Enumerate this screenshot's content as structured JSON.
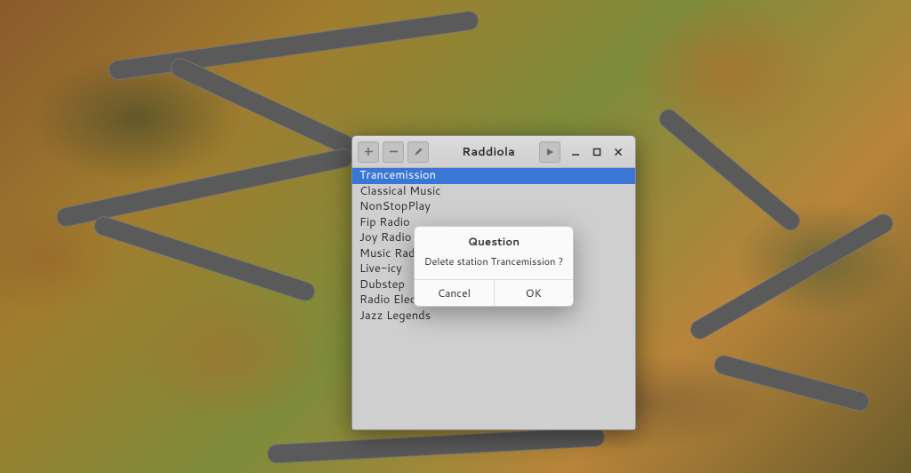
{
  "app": {
    "title": "Raddiola",
    "toolbar": {
      "add_icon": "plus-icon",
      "remove_icon": "minus-icon",
      "edit_icon": "pencil-icon",
      "play_icon": "play-icon"
    },
    "window_controls": {
      "minimize_icon": "minimize-icon",
      "maximize_icon": "maximize-icon",
      "close_icon": "close-icon"
    }
  },
  "stations": [
    {
      "name": "Trancemission",
      "selected": true
    },
    {
      "name": "Classical Music",
      "selected": false
    },
    {
      "name": "NonStopPlay",
      "selected": false
    },
    {
      "name": "Fip Radio",
      "selected": false
    },
    {
      "name": "Joy Radio",
      "selected": false
    },
    {
      "name": "Music Radio",
      "selected": false
    },
    {
      "name": "Live-icy",
      "selected": false
    },
    {
      "name": "Dubstep",
      "selected": false
    },
    {
      "name": "Radio Electron",
      "selected": false
    },
    {
      "name": "Jazz Legends",
      "selected": false
    }
  ],
  "dialog": {
    "title": "Question",
    "message": "Delete station Trancemission ?",
    "cancel_label": "Cancel",
    "ok_label": "OK"
  }
}
